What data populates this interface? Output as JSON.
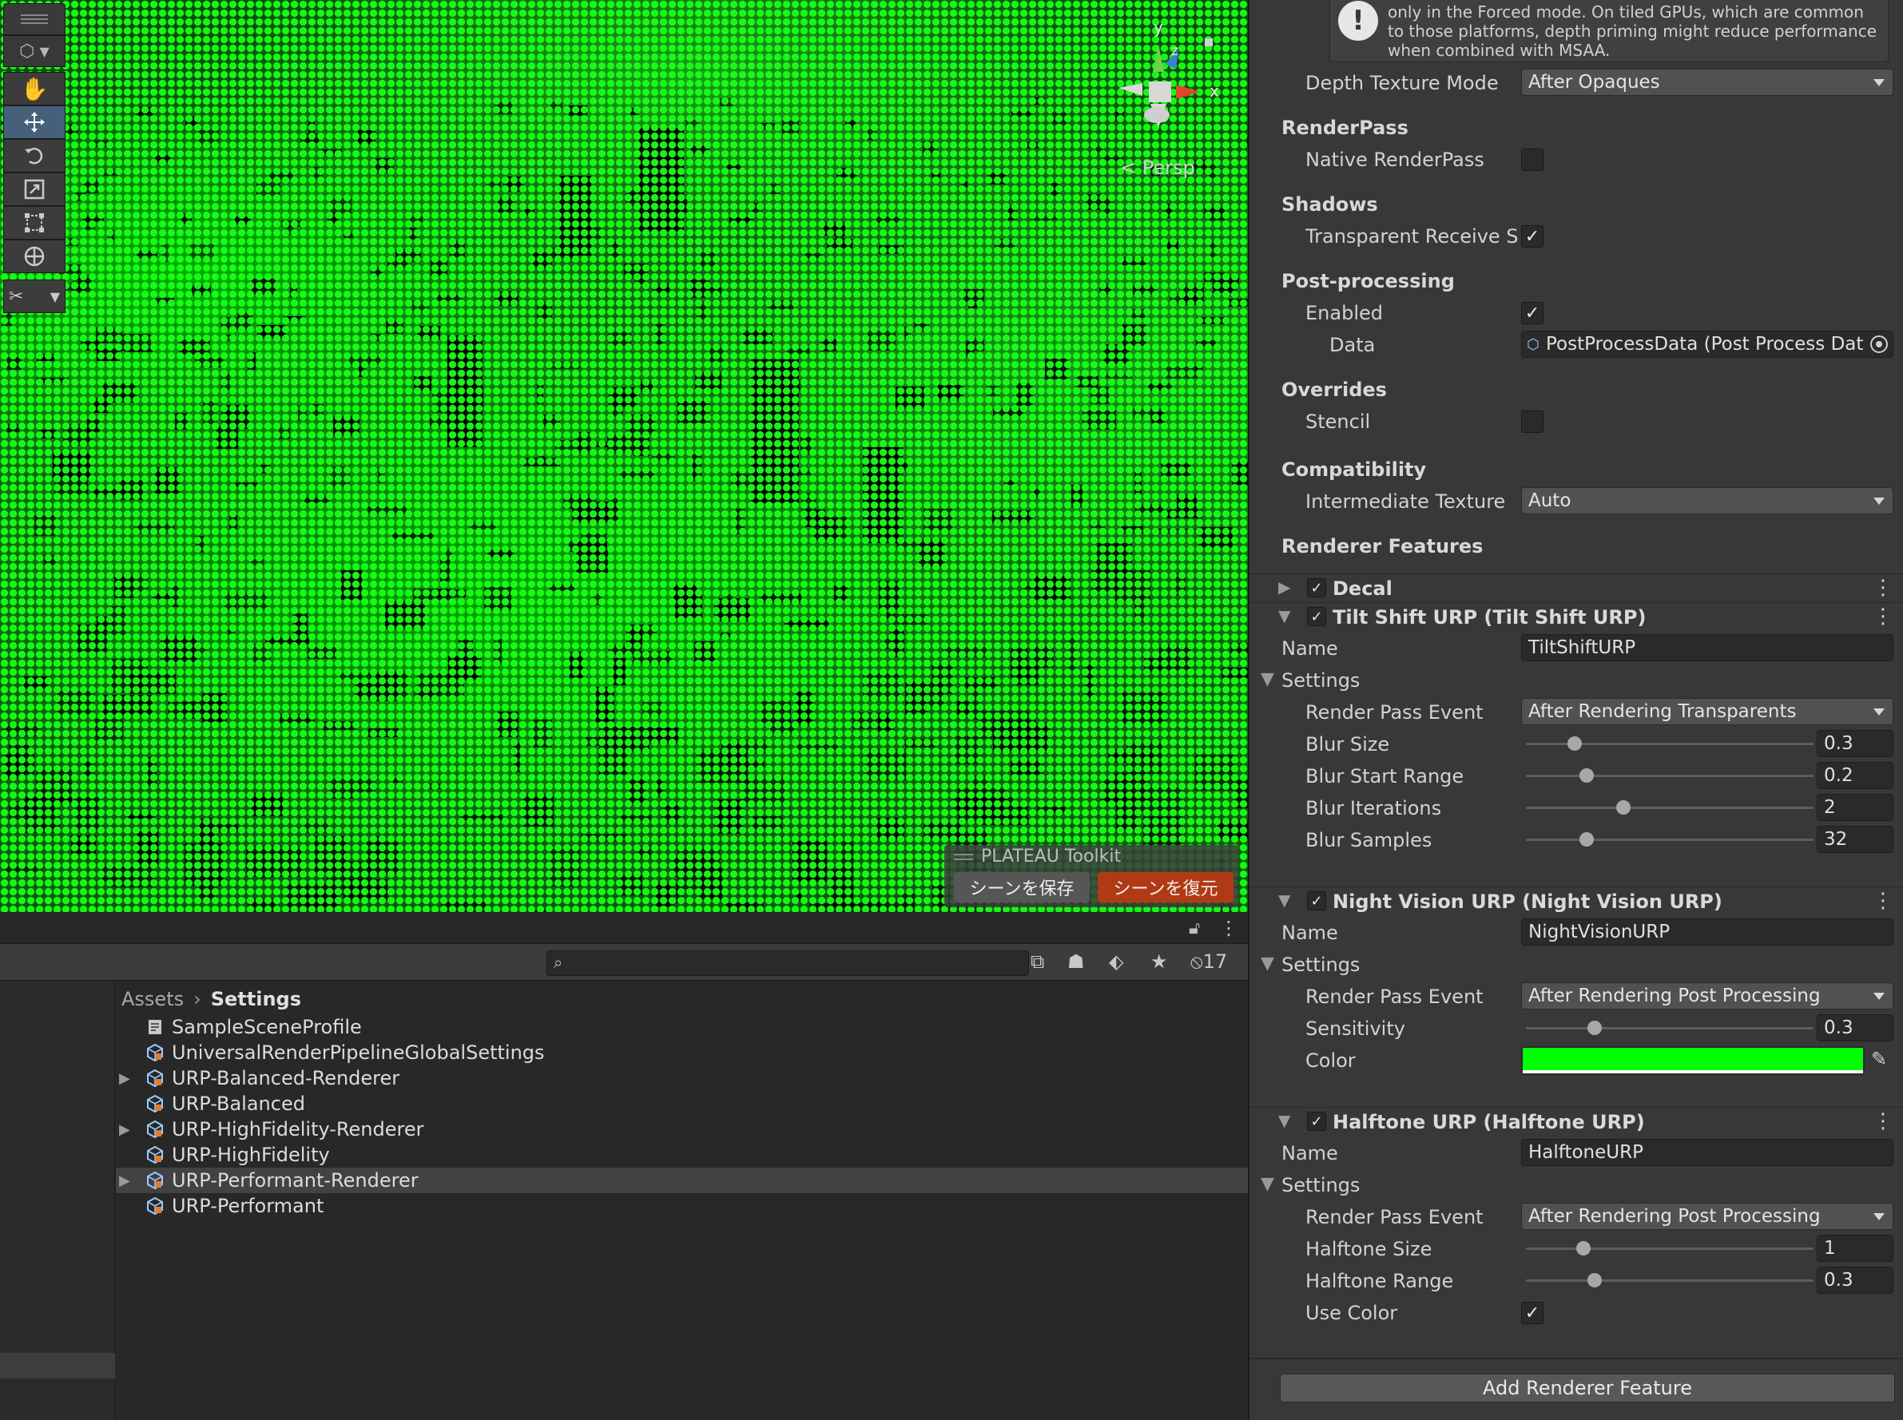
{
  "scene": {
    "gizmo_axes": {
      "y": "y",
      "z": "z",
      "x": "x"
    },
    "persp_label": "< Persp",
    "plateau": {
      "title": "PLATEAU Toolkit",
      "save_label": "シーンを保存",
      "restore_label": "シーンを復元"
    }
  },
  "project": {
    "hidden_count": "17",
    "breadcrumb": [
      "Assets",
      "Settings"
    ],
    "assets": [
      {
        "name": "SampleSceneProfile",
        "icon": "volume-profile-icon",
        "foldable": false,
        "selected": false
      },
      {
        "name": "UniversalRenderPipelineGlobalSettings",
        "icon": "scriptable-object-icon",
        "foldable": false,
        "selected": false
      },
      {
        "name": "URP-Balanced-Renderer",
        "icon": "scriptable-object-icon",
        "foldable": true,
        "selected": false
      },
      {
        "name": "URP-Balanced",
        "icon": "scriptable-object-icon",
        "foldable": false,
        "selected": false
      },
      {
        "name": "URP-HighFidelity-Renderer",
        "icon": "scriptable-object-icon",
        "foldable": true,
        "selected": false
      },
      {
        "name": "URP-HighFidelity",
        "icon": "scriptable-object-icon",
        "foldable": false,
        "selected": false
      },
      {
        "name": "URP-Performant-Renderer",
        "icon": "scriptable-object-icon",
        "foldable": true,
        "selected": true
      },
      {
        "name": "URP-Performant",
        "icon": "scriptable-object-icon",
        "foldable": false,
        "selected": false
      }
    ]
  },
  "inspector": {
    "info_text": "only in the Forced mode. On tiled GPUs, which are common to those platforms, depth priming might reduce performance when combined with MSAA.",
    "depth_texture_mode": {
      "label": "Depth Texture Mode",
      "value": "After Opaques"
    },
    "renderpass": {
      "title": "RenderPass",
      "native_label": "Native RenderPass",
      "native_checked": false
    },
    "shadows": {
      "title": "Shadows",
      "transparent_label": "Transparent Receive Sh",
      "transparent_checked": true
    },
    "postprocessing": {
      "title": "Post-processing",
      "enabled_label": "Enabled",
      "enabled_checked": true,
      "data_label": "Data",
      "data_value": "PostProcessData (Post Process Dat"
    },
    "overrides": {
      "title": "Overrides",
      "stencil_label": "Stencil",
      "stencil_checked": false
    },
    "compatibility": {
      "title": "Compatibility",
      "intermediate_label": "Intermediate Texture",
      "intermediate_value": "Auto"
    },
    "renderer_features_title": "Renderer Features",
    "decal": {
      "title": "Decal",
      "enabled": true
    },
    "tilt_shift": {
      "title": "Tilt Shift URP (Tilt Shift URP)",
      "enabled": true,
      "name_label": "Name",
      "name_value": "TiltShiftURP",
      "settings_label": "Settings",
      "render_pass_label": "Render Pass Event",
      "render_pass_value": "After Rendering Transparents",
      "blur_size_label": "Blur Size",
      "blur_size_value": "0.3",
      "blur_size_fraction": 0.17,
      "blur_start_label": "Blur Start Range",
      "blur_start_value": "0.2",
      "blur_start_fraction": 0.21,
      "blur_iter_label": "Blur Iterations",
      "blur_iter_value": "2",
      "blur_iter_fraction": 0.34,
      "blur_samples_label": "Blur Samples",
      "blur_samples_value": "32",
      "blur_samples_fraction": 0.21
    },
    "night_vision": {
      "title": "Night Vision URP (Night Vision URP)",
      "enabled": true,
      "name_label": "Name",
      "name_value": "NightVisionURP",
      "settings_label": "Settings",
      "render_pass_label": "Render Pass Event",
      "render_pass_value": "After Rendering Post Processing",
      "sensitivity_label": "Sensitivity",
      "sensitivity_value": "0.3",
      "sensitivity_fraction": 0.24,
      "color_label": "Color",
      "color_hex": "#00ff00"
    },
    "halftone": {
      "title": "Halftone URP (Halftone URP)",
      "enabled": true,
      "name_label": "Name",
      "name_value": "HalftoneURP",
      "settings_label": "Settings",
      "render_pass_label": "Render Pass Event",
      "render_pass_value": "After Rendering Post Processing",
      "size_label": "Halftone Size",
      "size_value": "1",
      "size_fraction": 0.2,
      "range_label": "Halftone Range",
      "range_value": "0.3",
      "range_fraction": 0.24,
      "use_color_label": "Use Color",
      "use_color_checked": true
    },
    "add_feature_label": "Add Renderer Feature"
  },
  "colors": {
    "accent_green": "#00ff00",
    "restore_button": "#b13a16",
    "active_tool": "#46607c"
  }
}
